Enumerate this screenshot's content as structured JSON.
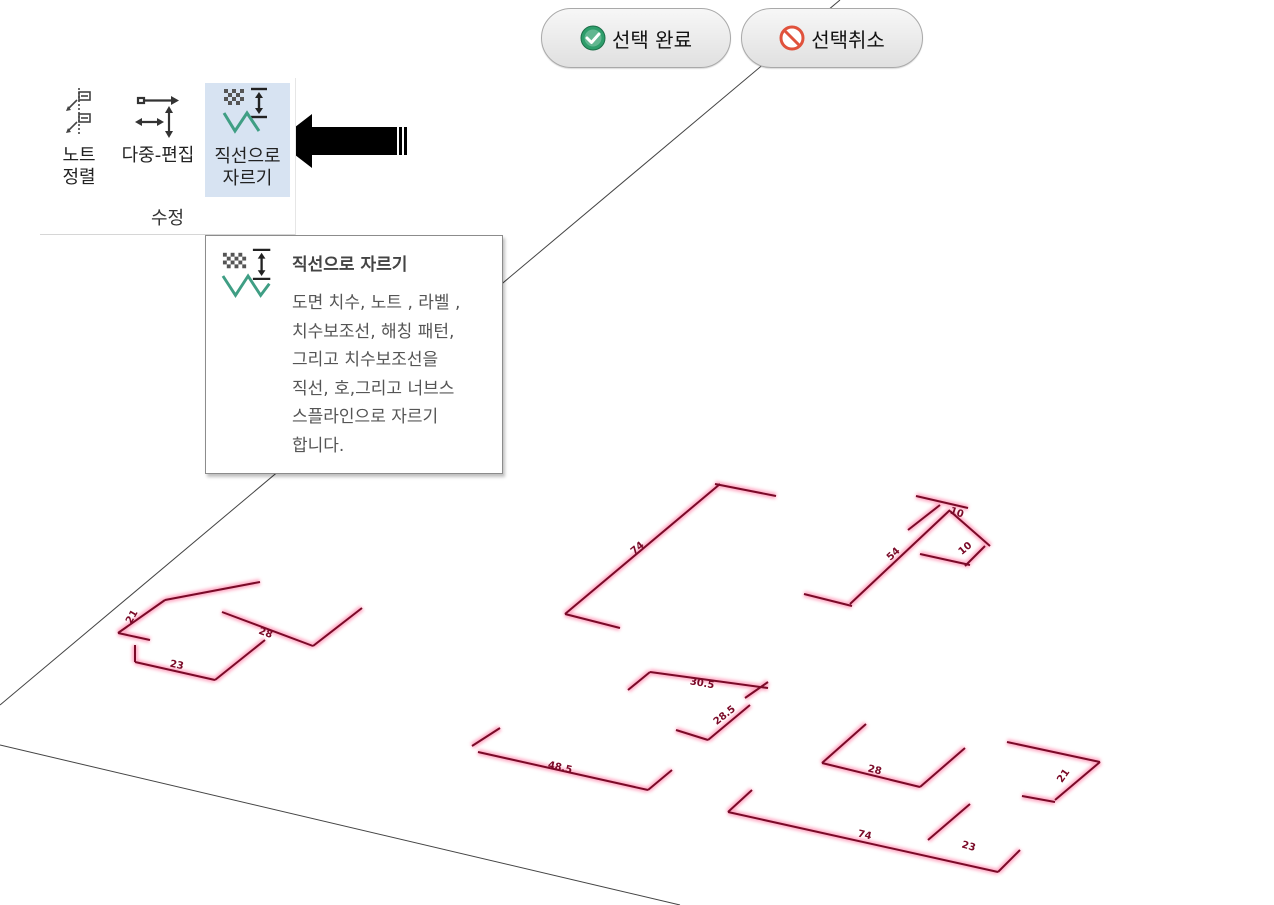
{
  "toolbar": {
    "done_label": "선택 완료",
    "cancel_label": "선택취소"
  },
  "ribbon": {
    "group_label": "수정",
    "buttons": [
      {
        "line1": "노트",
        "line2": "정렬"
      },
      {
        "line1": "다중-편집",
        "line2": ""
      },
      {
        "line1": "직선으로",
        "line2": "자르기"
      }
    ]
  },
  "tooltip": {
    "title": "직선으로 자르기",
    "lines": [
      "도면 치수, 노트 , 라벨 ,",
      "치수보조선, 해칭 패턴,",
      "그리고 치수보조선을",
      "직선, 호,그리고 너브스",
      "스플라인으로 자르기",
      "합니다."
    ]
  },
  "dimensions": [
    "74",
    "54",
    "10",
    "10",
    "21",
    "28",
    "23",
    "30.5",
    "28.5",
    "48.5",
    "28",
    "21",
    "74",
    "23"
  ],
  "colors": {
    "dimension": "#8a0a2a",
    "dimension_glow": "#ff7aa5",
    "accent_green": "#2e9e6b",
    "cancel_red": "#e0523c",
    "highlight": "#d7e3f2"
  }
}
